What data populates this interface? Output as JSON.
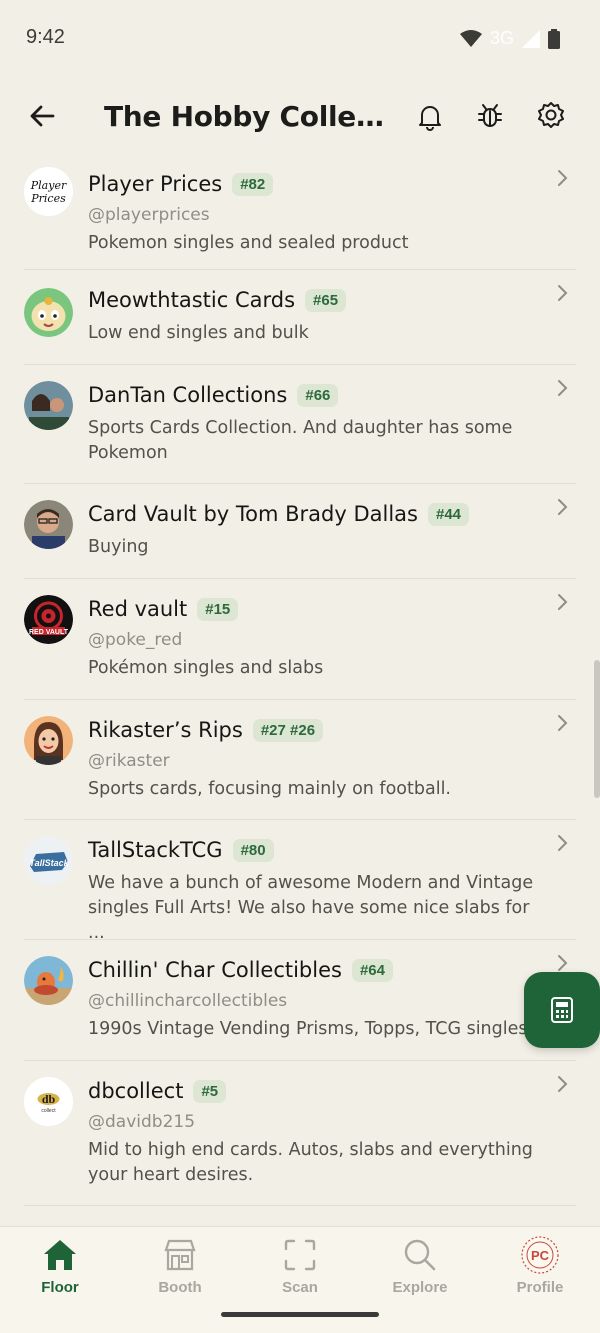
{
  "status_bar": {
    "time": "9:42",
    "network": "3G"
  },
  "app_bar": {
    "title": "The Hobby Collector..."
  },
  "list": [
    {
      "name": "Player Prices",
      "badge": "#82",
      "handle": "@playerprices",
      "desc": "Pokemon singles and sealed product",
      "avatar": "player-prices-logo"
    },
    {
      "name": "Meowthtastic Cards",
      "badge": "#65",
      "handle": "",
      "desc": "Low end singles and bulk",
      "avatar": "meowth-avatar"
    },
    {
      "name": "DanTan Collections",
      "badge": "#66",
      "handle": "",
      "desc": "Sports Cards Collection. And daughter has some Pokemon",
      "avatar": "dantan-photo"
    },
    {
      "name": "Card Vault by Tom Brady Dallas",
      "badge": "#44",
      "handle": "",
      "desc": "Buying",
      "avatar": "card-vault-photo"
    },
    {
      "name": "Red vault",
      "badge": "#15",
      "handle": "@poke_red",
      "desc": "Pokémon singles and slabs",
      "avatar": "red-vault-logo"
    },
    {
      "name": "Rikaster’s Rips",
      "badge": "#27 #26",
      "handle": "@rikaster",
      "desc": "Sports cards, focusing mainly on football.",
      "avatar": "rikaster-avatar"
    },
    {
      "name": "TallStackTCG",
      "badge": "#80",
      "handle": "",
      "desc": "We have a bunch of awesome Modern and Vintage singles Full Arts! We also have some nice slabs for ...",
      "avatar": "tallstack-logo"
    },
    {
      "name": "Chillin' Char Collectibles",
      "badge": "#64",
      "handle": "@chillincharcollectibles",
      "desc": "1990s Vintage Vending Prisms, Topps, TCG singles",
      "avatar": "charmander-avatar"
    },
    {
      "name": "dbcollect",
      "badge": "#5",
      "handle": "@davidb215",
      "desc": "Mid to high end cards. Autos, slabs and everything your heart desires.",
      "avatar": "dbcollect-logo"
    }
  ],
  "bottom_nav": [
    {
      "label": "Floor",
      "icon": "home-icon",
      "active": true
    },
    {
      "label": "Booth",
      "icon": "store-icon",
      "active": false
    },
    {
      "label": "Scan",
      "icon": "scan-icon",
      "active": false
    },
    {
      "label": "Explore",
      "icon": "search-icon",
      "active": false
    },
    {
      "label": "Profile",
      "icon": "profile-logo-icon",
      "active": false
    }
  ],
  "colors": {
    "accent": "#1f6438",
    "badge_bg": "#dde6d2",
    "badge_text": "#2c6a3e",
    "background": "#f2f0e6"
  }
}
